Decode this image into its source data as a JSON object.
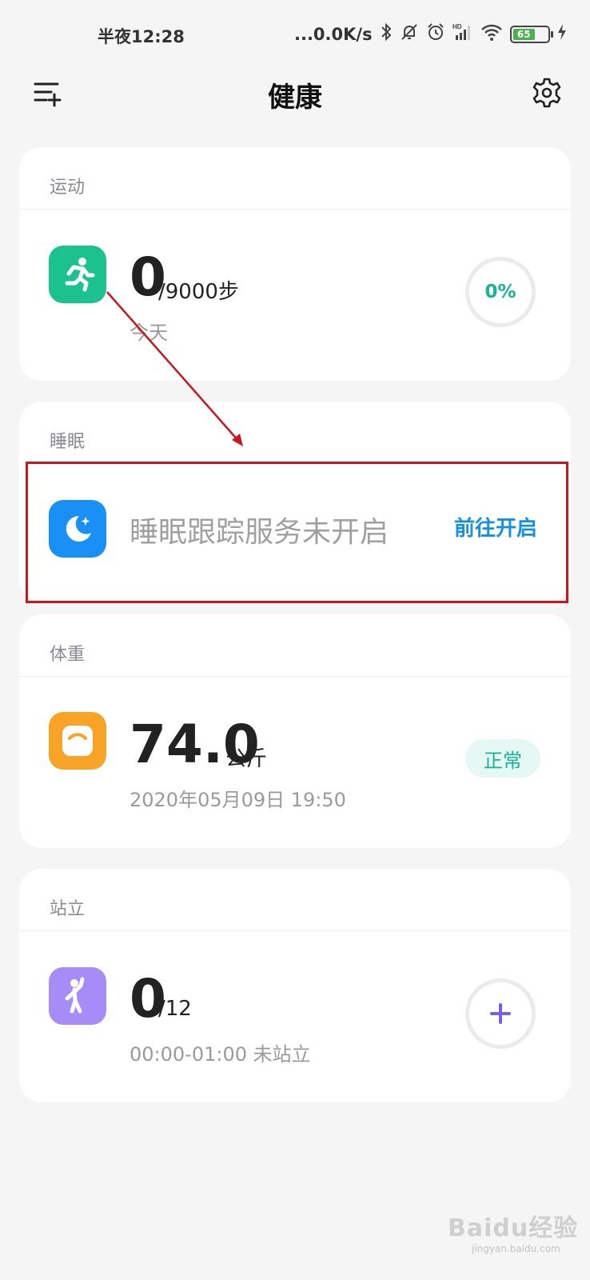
{
  "status_bar": {
    "time": "半夜12:28",
    "network_speed": "...0.0K/s",
    "battery_level": "65",
    "icons": [
      "bluetooth-icon",
      "mute-icon",
      "alarm-icon",
      "signal-icon",
      "wifi-icon",
      "battery-icon",
      "charging-icon"
    ]
  },
  "topbar": {
    "title": "健康",
    "menu_icon": "menu-add-icon",
    "settings_icon": "gear-icon"
  },
  "exercise": {
    "header": "运动",
    "steps": "0",
    "goal": "/9000步",
    "sub": "今天",
    "progress_label": "0%",
    "progress": 0,
    "icon": "running-icon",
    "icon_color": "#1cc28d"
  },
  "sleep": {
    "header": "睡眠",
    "message": "睡眠跟踪服务未开启",
    "action": "前往开启",
    "icon": "moon-icon",
    "icon_color": "#1890f5",
    "action_color": "#1890e0"
  },
  "weight": {
    "header": "体重",
    "value": "74.0",
    "unit": "公斤",
    "timestamp": "2020年05月09日 19:50",
    "status": "正常",
    "icon": "scale-icon",
    "icon_color": "#f7a325"
  },
  "standing": {
    "header": "站立",
    "count": "0",
    "goal": "/12",
    "sub": "00:00-01:00 未站立",
    "icon": "standing-person-icon",
    "icon_color": "#a58cf7",
    "add_icon": "plus-icon"
  },
  "watermark": {
    "brand": "Baidu经验",
    "url": "jingyan.baidu.com"
  }
}
